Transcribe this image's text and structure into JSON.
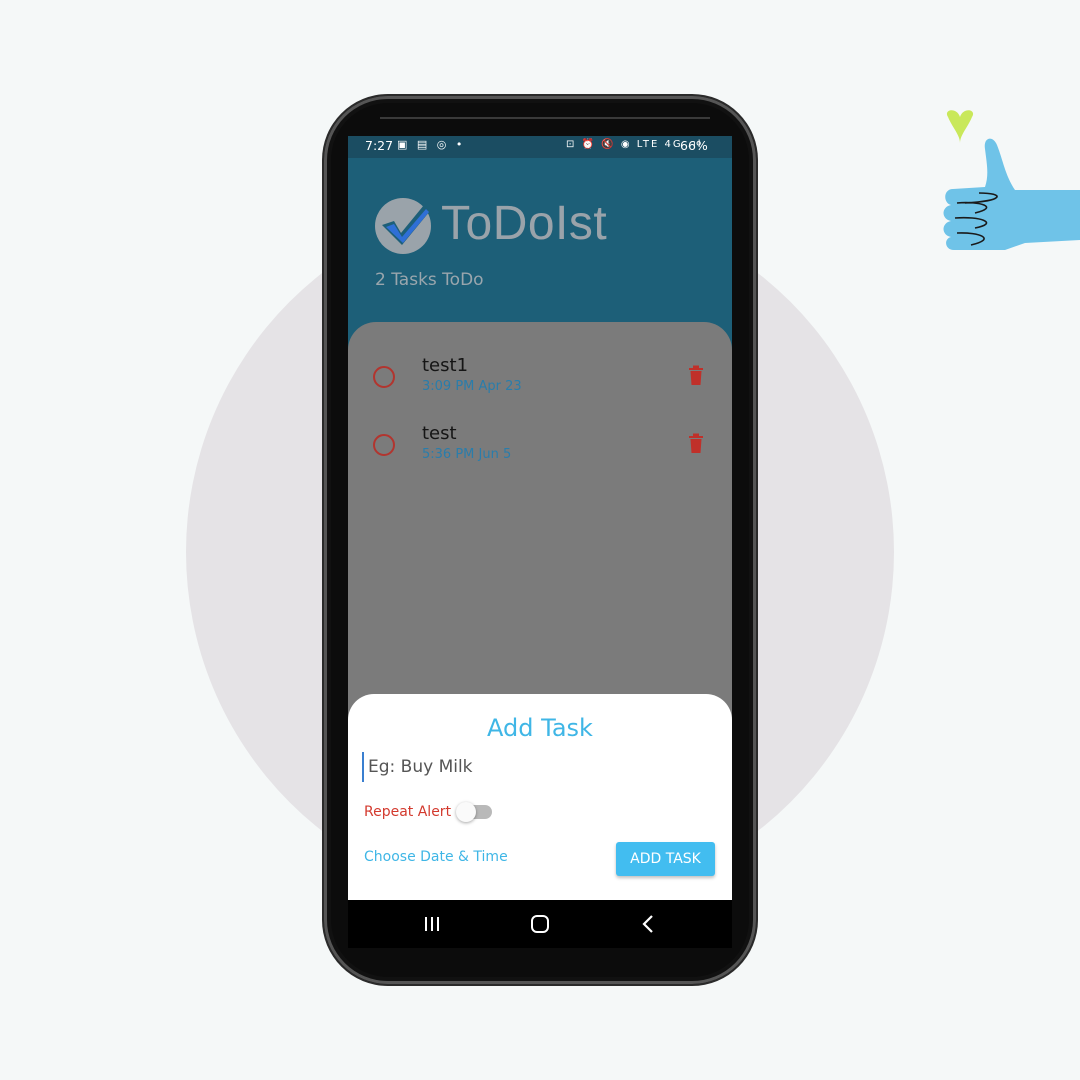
{
  "status_bar": {
    "time": "7:27",
    "left_icons": "▣ ▤ ◎ •",
    "right_icons": "⊡ ⏰ 🔇 ◉ LTE 4G .ıl",
    "battery": "66%"
  },
  "header": {
    "app_name": "ToDoIst",
    "task_count": "2 Tasks ToDo"
  },
  "tasks": [
    {
      "title": "test1",
      "time": "3:09 PM Apr 23"
    },
    {
      "title": "test",
      "time": "5:36 PM Jun 5"
    }
  ],
  "add_task_sheet": {
    "title": "Add Task",
    "input_placeholder": "Eg: Buy Milk",
    "input_value": "",
    "repeat_label": "Repeat Alert",
    "repeat_enabled": false,
    "choose_date_label": "Choose Date & Time",
    "add_button_label": "ADD TASK"
  },
  "colors": {
    "header_bg": "#1d5f78",
    "accent": "#42bdf0",
    "danger": "#d33a2e",
    "scrim": "#7b7b7b"
  },
  "icons": {
    "logo": "check-circle-icon",
    "task_status": "circle-outline-icon",
    "delete": "trash-icon",
    "nav_recent": "recent-apps-icon",
    "nav_home": "home-icon",
    "nav_back": "back-icon",
    "decoration": "thumbs-up-icon"
  }
}
